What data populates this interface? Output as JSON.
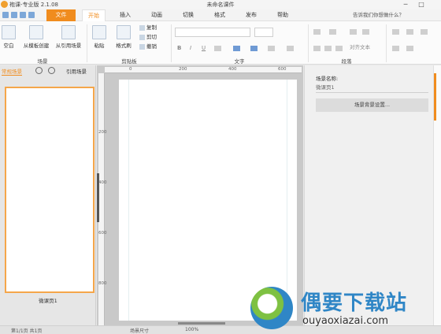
{
  "window": {
    "app_title": "袍课-专业版 2.1.08",
    "doc_title": "未命名课件",
    "min_label": "─",
    "max_label": "□"
  },
  "tabs": {
    "file": "文件",
    "items": [
      "开始",
      "插入",
      "动画",
      "切换",
      "格式",
      "发布",
      "帮助"
    ],
    "active": "开始"
  },
  "tell_me": "告诉我们你想做什么？",
  "ribbon": {
    "scene_group": {
      "label": "场景",
      "buttons": [
        "空白",
        "从模板创建",
        "从引用场景"
      ]
    },
    "clipboard_group": {
      "label": "剪贴板",
      "paste": "粘贴",
      "format_painter": "格式刷",
      "copy": "复制",
      "cut": "剪切",
      "undo": "撤销"
    },
    "text_group": {
      "label": "文字",
      "bold": "B",
      "italic": "I",
      "underline": "U"
    },
    "paragraph_group": {
      "label": "段落",
      "align_text": "对齐文本"
    }
  },
  "left_panel": {
    "tab_normal": "常规场景",
    "tab_reference": "引用场景",
    "slide_caption": "微课页1"
  },
  "canvas": {
    "ruler_h": [
      "0",
      "200",
      "400",
      "600"
    ],
    "ruler_v": [
      "200",
      "400",
      "600",
      "800"
    ]
  },
  "right_panel": {
    "scene_name_label": "场景名称:",
    "scene_name_value": "微课页1",
    "bg_button": "场景背景设置..."
  },
  "statusbar": {
    "page_info": "第1/1页 共1页",
    "zoom_label": "场景尺寸",
    "zoom_value": "100%"
  },
  "watermark": {
    "text": "偶要下载站",
    "url": "ouyaoxiazai.com"
  }
}
